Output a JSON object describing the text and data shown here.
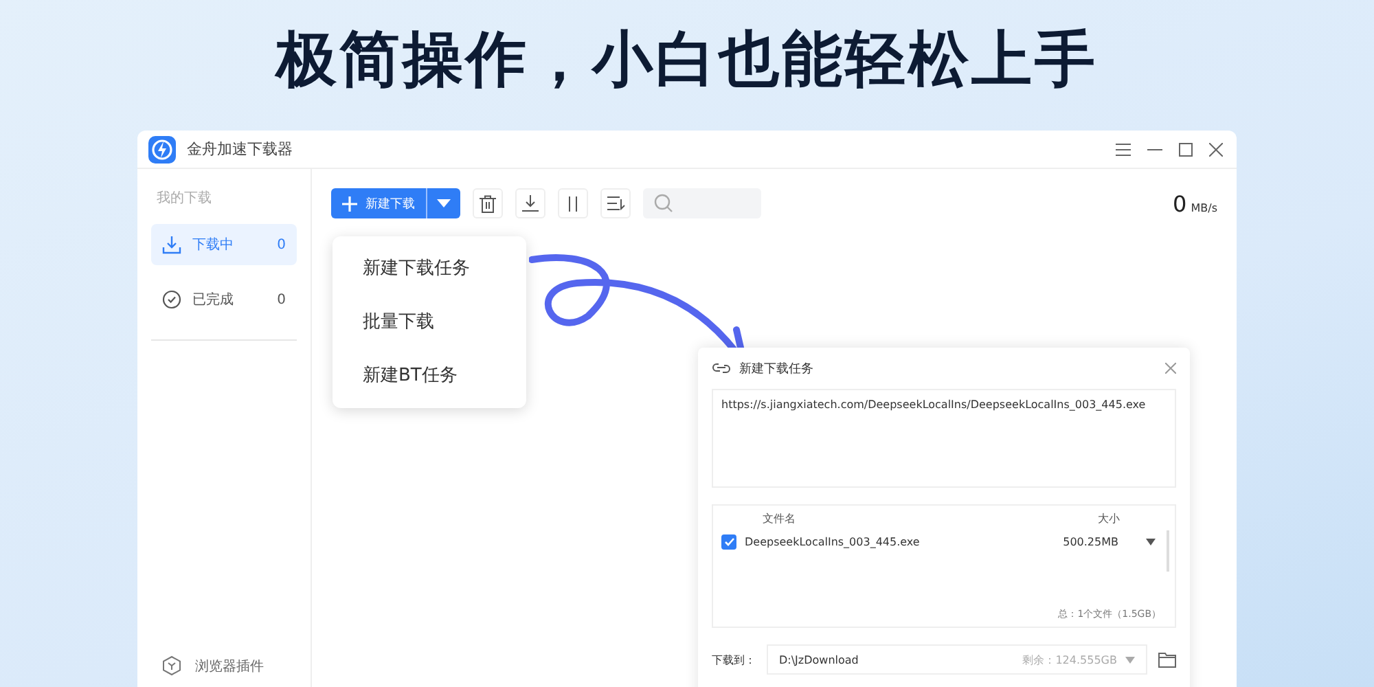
{
  "headline": "极简操作，小白也能轻松上手",
  "window": {
    "title": "金舟加速下载器"
  },
  "sidebar": {
    "heading": "我的下载",
    "items": [
      {
        "label": "下载中",
        "count": "0",
        "selected": true,
        "kind": "downloading"
      },
      {
        "label": "已完成",
        "count": "0",
        "selected": false,
        "kind": "done"
      }
    ],
    "plugin": "浏览器插件"
  },
  "toolbar": {
    "new_button": "新建下载",
    "speed_value": "0",
    "speed_unit": "MB/s"
  },
  "menu": {
    "items": [
      "新建下载任务",
      "批量下载",
      "新建BT任务"
    ]
  },
  "dialog": {
    "title": "新建下载任务",
    "url": "https://s.jiangxiatech.com/DeepseekLocalIns/DeepseekLocalIns_003_445.exe",
    "columns": [
      "文件名",
      "大小"
    ],
    "files": [
      {
        "name": "DeepseekLocalIns_003_445.exe",
        "size": "500.25MB",
        "checked": true
      }
    ],
    "summary": "总：1个文件（1.5GB）",
    "save_label": "下载到：",
    "save_path": "D:\\JzDownload",
    "free_space": "剩余：124.555GB"
  }
}
